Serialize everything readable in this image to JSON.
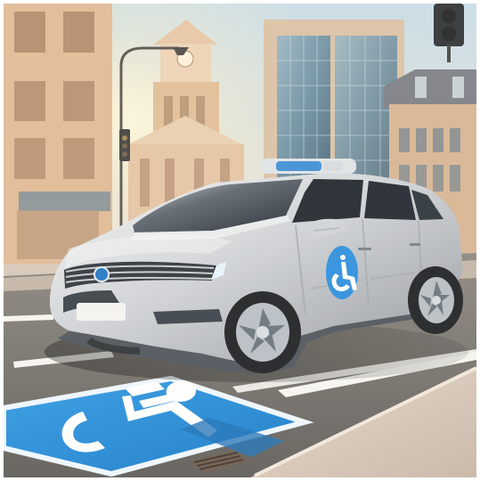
{
  "scene": {
    "subject": "electric-suv",
    "symbol": "wheelchair-access-symbol",
    "setting": "city-street-parking-space",
    "colors": {
      "sky": "#d7e6ef",
      "sun": "#fff1c8",
      "building_warm": "#d8b08a",
      "building_light": "#ecd1b0",
      "glass": "#7ea3b7",
      "road": "#6f6d69",
      "sidewalk": "#d9cabb",
      "car_body": "#c9cdd2",
      "car_shadow": "#646a72",
      "accent_blue": "#1f87d8",
      "line_white": "#f6f6f2"
    }
  }
}
